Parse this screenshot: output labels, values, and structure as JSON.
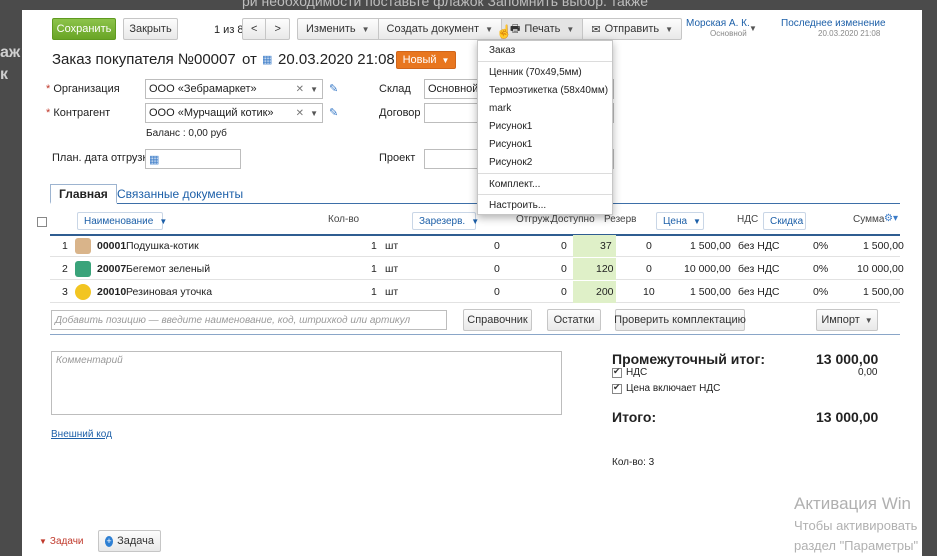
{
  "backdrop": {
    "top_hint": "ри необходимости поставьте флажок Запомнить выбор. также",
    "left_hint_1": "аж",
    "left_hint_2": "к"
  },
  "toolbar": {
    "save_label": "Сохранить",
    "close_label": "Закрыть",
    "pager": "1 из 8",
    "prev": "<",
    "next": ">",
    "edit_label": "Изменить",
    "create_doc_label": "Создать документ",
    "print_label": "Печать",
    "send_label": "Отправить"
  },
  "user": {
    "name": "Морская А. К.",
    "role": "Основной"
  },
  "last_change": {
    "label": "Последнее изменение",
    "date": "20.03.2020 21:08"
  },
  "doc": {
    "title": "Заказ покупателя №",
    "number": "00007",
    "from": "от",
    "date": "20.03.2020 21:08",
    "status": "Новый"
  },
  "form": {
    "org_label": "Организация",
    "org_value": "ООО «Зебрамаркет»",
    "contractor_label": "Контрагент",
    "contractor_value": "ООО «Мурчащий котик»",
    "balance": "Баланс : 0,00 руб",
    "ship_date_label": "План. дата отгрузки",
    "warehouse_label": "Склад",
    "warehouse_value": "Основной с",
    "contract_label": "Договор",
    "project_label": "Проект"
  },
  "print_menu": {
    "items": [
      "Заказ",
      "Ценник (70x49,5мм)",
      "Термоэтикетка (58x40мм)",
      "mark",
      "Рисунок1",
      "Рисунок1",
      "Рисунок2",
      "Комплект...",
      "Настроить..."
    ]
  },
  "tabs": [
    "Главная",
    "Связанные документы"
  ],
  "table": {
    "headers": {
      "name": "Наименование",
      "qty": "Кол-во",
      "reserved": "Зарезерв.",
      "shipped": "Отгруж.",
      "available": "Доступно",
      "reserve": "Резерв",
      "price": "Цена",
      "vat": "НДС",
      "discount": "Скидка",
      "sum": "Сумма"
    },
    "rows": [
      {
        "n": "1",
        "code": "00001",
        "name": "Подушка-котик",
        "qty": "1",
        "unit": "шт",
        "reserved": "0",
        "shipped": "0",
        "available": "37",
        "reserve": "0",
        "price": "1 500,00",
        "vat": "без НДС",
        "discount": "0%",
        "sum": "1 500,00",
        "thumb": "#d9b48a"
      },
      {
        "n": "2",
        "code": "20007",
        "name": "Бегемот зеленый",
        "qty": "1",
        "unit": "шт",
        "reserved": "0",
        "shipped": "0",
        "available": "120",
        "reserve": "0",
        "price": "10 000,00",
        "vat": "без НДС",
        "discount": "0%",
        "sum": "10 000,00",
        "thumb": "#3aa37a"
      },
      {
        "n": "3",
        "code": "20010",
        "name": "Резиновая уточка",
        "qty": "1",
        "unit": "шт",
        "reserved": "0",
        "shipped": "0",
        "available": "200",
        "reserve": "10",
        "price": "1 500,00",
        "vat": "без НДС",
        "discount": "0%",
        "sum": "1 500,00",
        "thumb": "#f2c521"
      }
    ]
  },
  "add_row": {
    "placeholder": "Добавить позицию — введите наименование, код, штрихкод или артикул",
    "catalog": "Справочник",
    "remains": "Остатки",
    "check_kit": "Проверить комплектацию",
    "import": "Импорт"
  },
  "comment_placeholder": "Комментарий",
  "external_code": "Внешний код",
  "totals": {
    "subtotal_label": "Промежуточный итог:",
    "subtotal": "13 000,00",
    "vat_label": "НДС",
    "vat_value": "0,00",
    "price_incl_vat": "Цена включает НДС",
    "total_label": "Итого:",
    "total": "13 000,00",
    "count": "Кол-во: 3"
  },
  "bottom": {
    "tasks": "Задачи",
    "add_task": "Задача"
  },
  "activation": {
    "title": "Активация Win",
    "line1": "Чтобы активировать",
    "line2": "раздел \"Параметры\""
  }
}
